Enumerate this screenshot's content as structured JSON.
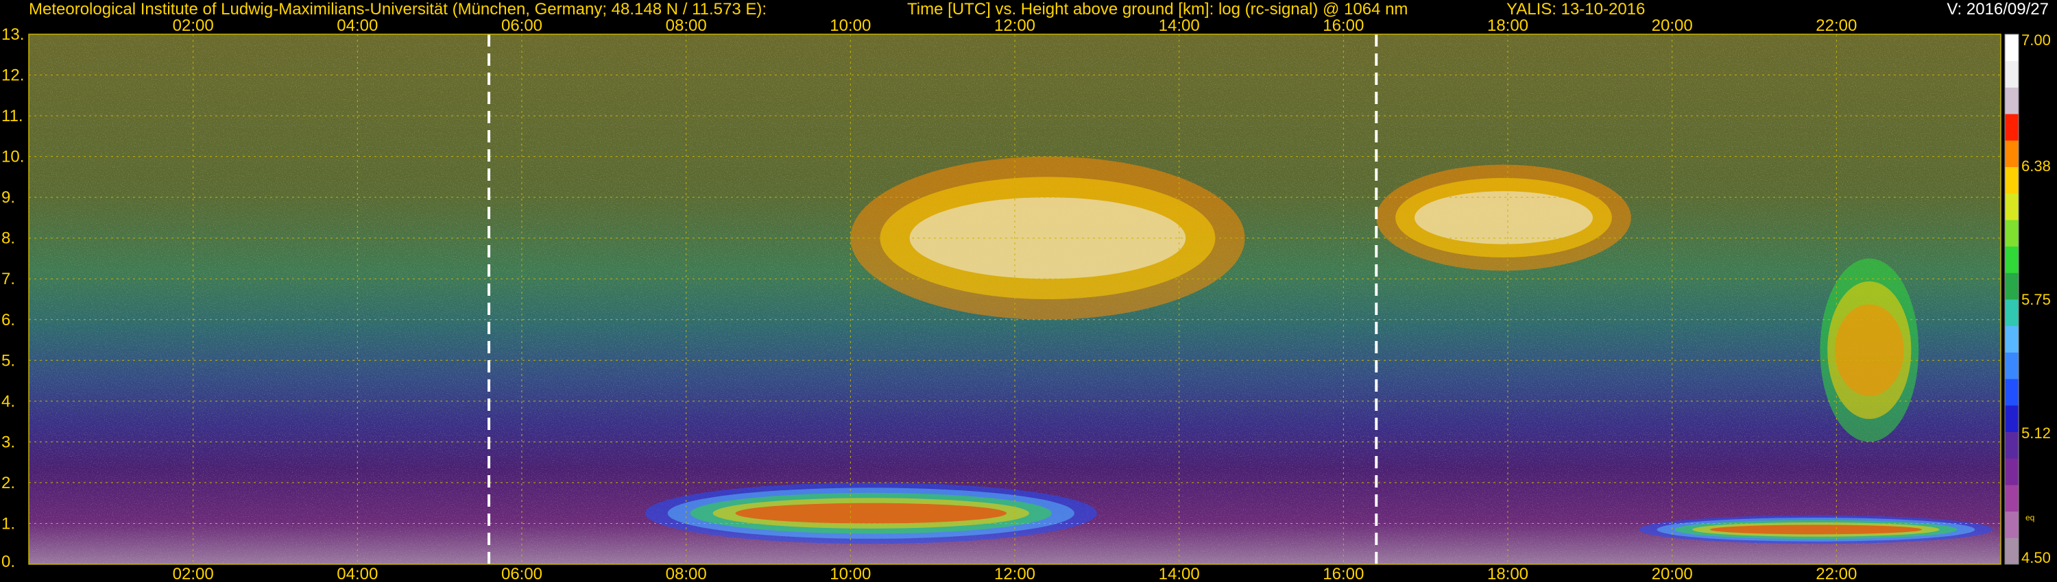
{
  "header": {
    "institute": "Meteorological Institute of Ludwig-Maximilians-Universität (München, Germany; 48.148 N / 11.573 E):",
    "plot_desc": "Time [UTC] vs. Height above ground [km]: log (rc-signal) @ 1064 nm",
    "site_date": "YALIS: 13-10-2016",
    "version": "V: 2016/09/27"
  },
  "colors": {
    "label": "#ffd400",
    "grid": "#c8b400",
    "marker": "#ffffff",
    "background": "#000000"
  },
  "chart_data": {
    "type": "heatmap",
    "title": "Time [UTC] vs. Height above ground [km]: log (rc-signal) @ 1064 nm",
    "xlabel": "Time [UTC]",
    "ylabel": "Height above ground [km]",
    "xlim_hours": [
      0.0,
      24.0
    ],
    "ylim_km": [
      0,
      13
    ],
    "x_ticks": [
      {
        "hour": 2,
        "label": "02:00"
      },
      {
        "hour": 4,
        "label": "04:00"
      },
      {
        "hour": 6,
        "label": "06:00"
      },
      {
        "hour": 8,
        "label": "08:00"
      },
      {
        "hour": 10,
        "label": "10:00"
      },
      {
        "hour": 12,
        "label": "12:00"
      },
      {
        "hour": 14,
        "label": "14:00"
      },
      {
        "hour": 16,
        "label": "16:00"
      },
      {
        "hour": 18,
        "label": "18:00"
      },
      {
        "hour": 20,
        "label": "20:00"
      },
      {
        "hour": 22,
        "label": "22:00"
      }
    ],
    "y_ticks": [
      {
        "km": 0,
        "label": "0."
      },
      {
        "km": 1,
        "label": "1."
      },
      {
        "km": 2,
        "label": "2."
      },
      {
        "km": 3,
        "label": "3."
      },
      {
        "km": 4,
        "label": "4."
      },
      {
        "km": 5,
        "label": "5."
      },
      {
        "km": 6,
        "label": "6."
      },
      {
        "km": 7,
        "label": "7."
      },
      {
        "km": 8,
        "label": "8."
      },
      {
        "km": 9,
        "label": "9."
      },
      {
        "km": 10,
        "label": "10."
      },
      {
        "km": 11,
        "label": "11."
      },
      {
        "km": 12,
        "label": "12."
      },
      {
        "km": 13,
        "label": "13."
      }
    ],
    "markers_hours": [
      5.6,
      16.4
    ],
    "grid": true,
    "colorbar": {
      "range": [
        4.5,
        7.0
      ],
      "ticks": [
        {
          "value": 7.0,
          "label": "7.00"
        },
        {
          "value": 6.38,
          "label": "6.38"
        },
        {
          "value": 5.75,
          "label": "5.75"
        },
        {
          "value": 5.12,
          "label": "5.12"
        },
        {
          "value": 4.5,
          "label": "4.50"
        }
      ],
      "extra_label": "eq",
      "colors": [
        "#a890a8",
        "#b070b0",
        "#a040a0",
        "#7a2a9a",
        "#5a2aa0",
        "#2020d0",
        "#2050ff",
        "#3a88ff",
        "#58b8ff",
        "#30c8b0",
        "#28a848",
        "#30d838",
        "#7fe030",
        "#d8e820",
        "#ffd000",
        "#ff8800",
        "#ff2000",
        "#d0c0d0",
        "#f0f0f0",
        "#ffffff"
      ]
    },
    "features": [
      {
        "name": "boundary layer",
        "time_h": [
          7.5,
          13.0
        ],
        "height_km": [
          0.5,
          2.0
        ]
      },
      {
        "name": "boundary layer",
        "time_h": [
          19.6,
          23.9
        ],
        "height_km": [
          0.5,
          1.2
        ]
      },
      {
        "name": "cirrus",
        "time_h": [
          10.0,
          14.8
        ],
        "height_km": [
          6.0,
          10.0
        ]
      },
      {
        "name": "cirrus",
        "time_h": [
          16.4,
          19.5
        ],
        "height_km": [
          7.2,
          9.8
        ]
      },
      {
        "name": "cloud",
        "time_h": [
          21.8,
          23.0
        ],
        "height_km": [
          3.0,
          7.5
        ]
      }
    ]
  }
}
